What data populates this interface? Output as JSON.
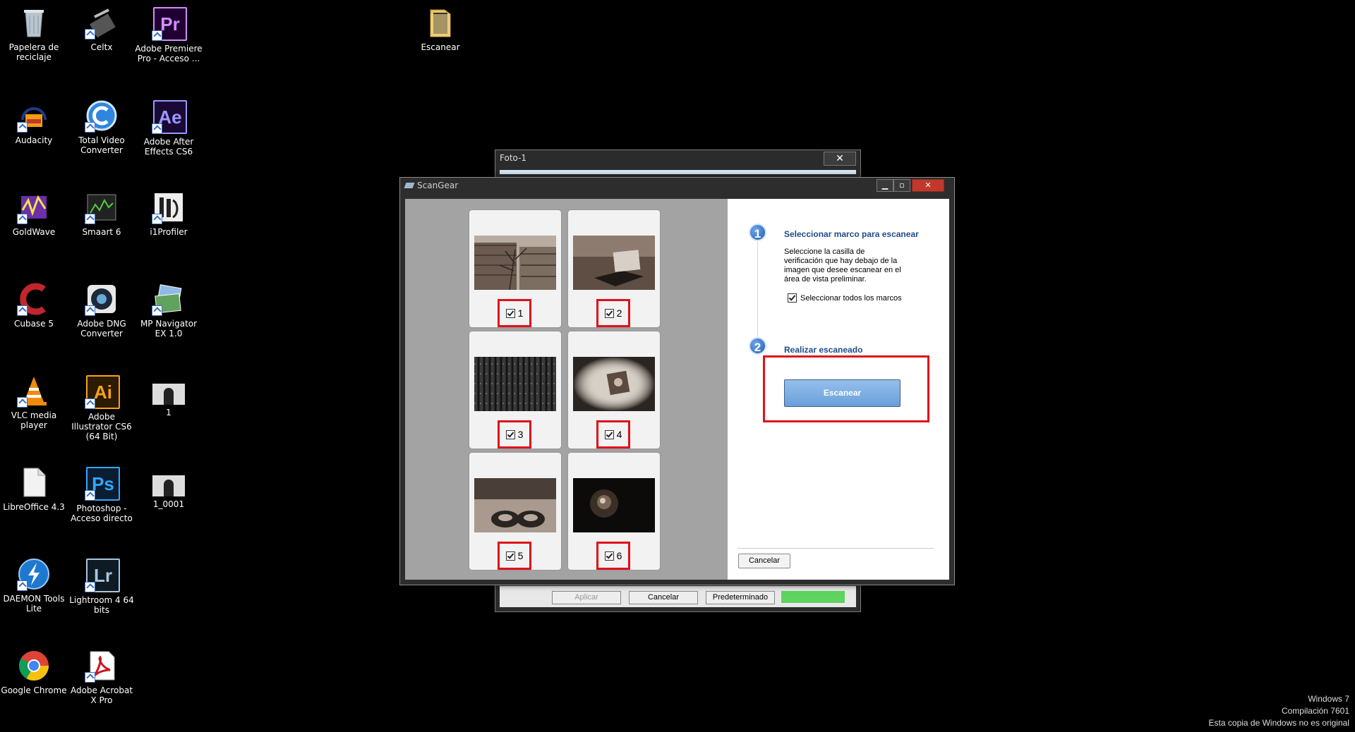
{
  "desktop": {
    "icons": [
      {
        "label": "Papelera de reciclaje"
      },
      {
        "label": "Celtx"
      },
      {
        "label": "Adobe Premiere Pro - Acceso ..."
      },
      {
        "label": "Escanear"
      },
      {
        "label": "Audacity"
      },
      {
        "label": "Total Video Converter"
      },
      {
        "label": "Adobe After Effects CS6"
      },
      {
        "label": "GoldWave"
      },
      {
        "label": "Smaart 6"
      },
      {
        "label": "i1Profiler"
      },
      {
        "label": "Cubase 5"
      },
      {
        "label": "Adobe DNG Converter"
      },
      {
        "label": "MP Navigator EX 1.0"
      },
      {
        "label": "VLC media player"
      },
      {
        "label": "Adobe Illustrator CS6 (64 Bit)"
      },
      {
        "label": "1"
      },
      {
        "label": "LibreOffice 4.3"
      },
      {
        "label": "Photoshop - Acceso directo"
      },
      {
        "label": "1_0001"
      },
      {
        "label": "DAEMON Tools Lite"
      },
      {
        "label": "Lightroom 4 64 bits"
      },
      {
        "label": "Google Chrome"
      },
      {
        "label": "Adobe Acrobat X Pro"
      }
    ],
    "badges": {
      "pr": "Pr",
      "ae": "Ae",
      "ai": "Ai",
      "ps": "Ps",
      "lr": "Lr"
    }
  },
  "foto_window": {
    "title": "Foto-1",
    "close": "✕",
    "buttons": {
      "apply": "Aplicar",
      "cancel": "Cancelar",
      "default": "Predeterminado"
    }
  },
  "scangear": {
    "title": "ScanGear",
    "controls": {
      "minimize": "▁",
      "maximize": "▫",
      "close": "✕"
    },
    "frames": [
      "1",
      "2",
      "3",
      "4",
      "5",
      "6"
    ],
    "step1": {
      "number": "1",
      "title": "Seleccionar marco para escanear",
      "description": "Seleccione la casilla de verificación que hay debajo de la imagen que desee escanear en el área de vista preliminar.",
      "select_all": "Seleccionar todos los marcos"
    },
    "step2": {
      "number": "2",
      "title": "Realizar escaneado",
      "scan_button": "Escanear"
    },
    "cancel_button": "Cancelar"
  },
  "watermark": {
    "line1": "Windows 7",
    "line2": "Compilación  7601",
    "line3": "Esta copia de Windows no es original"
  }
}
